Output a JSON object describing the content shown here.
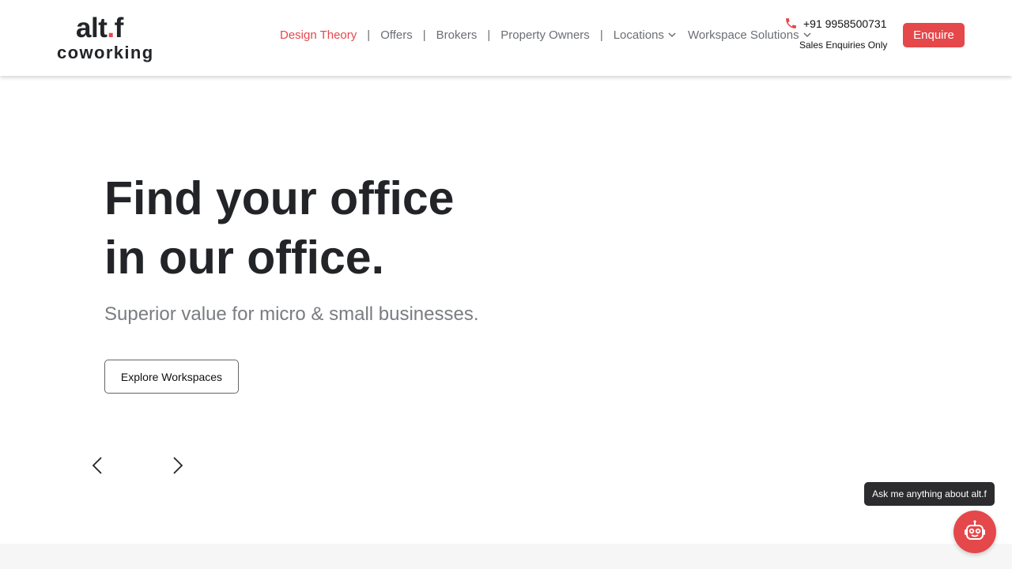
{
  "brand": {
    "logo_top_prefix": "alt",
    "logo_top_dot": ".",
    "logo_top_suffix": "f",
    "logo_bottom": "coworking",
    "accent_color": "#e4484b"
  },
  "nav": {
    "items": [
      {
        "label": "Design Theory",
        "active": true
      },
      {
        "label": "Offers"
      },
      {
        "label": "Brokers"
      },
      {
        "label": "Property Owners"
      },
      {
        "label": "Locations",
        "has_dropdown": true
      },
      {
        "label": "Workspace Solutions",
        "has_dropdown": true
      }
    ],
    "separator": "|"
  },
  "contact": {
    "phone": "+91 9958500731",
    "phone_note": "Sales Enquiries Only",
    "icon": "phone-icon"
  },
  "header": {
    "enquire_label": "Enquire"
  },
  "hero": {
    "title_line1": "Find your office",
    "title_line2": "in our office.",
    "subtitle": "Superior value for micro & small businesses.",
    "cta_label": "Explore Workspaces"
  },
  "carousel": {
    "prev_icon": "chevron-left-icon",
    "next_icon": "chevron-right-icon"
  },
  "chat": {
    "tooltip": "Ask me anything about alt.f",
    "icon": "robot-icon"
  }
}
